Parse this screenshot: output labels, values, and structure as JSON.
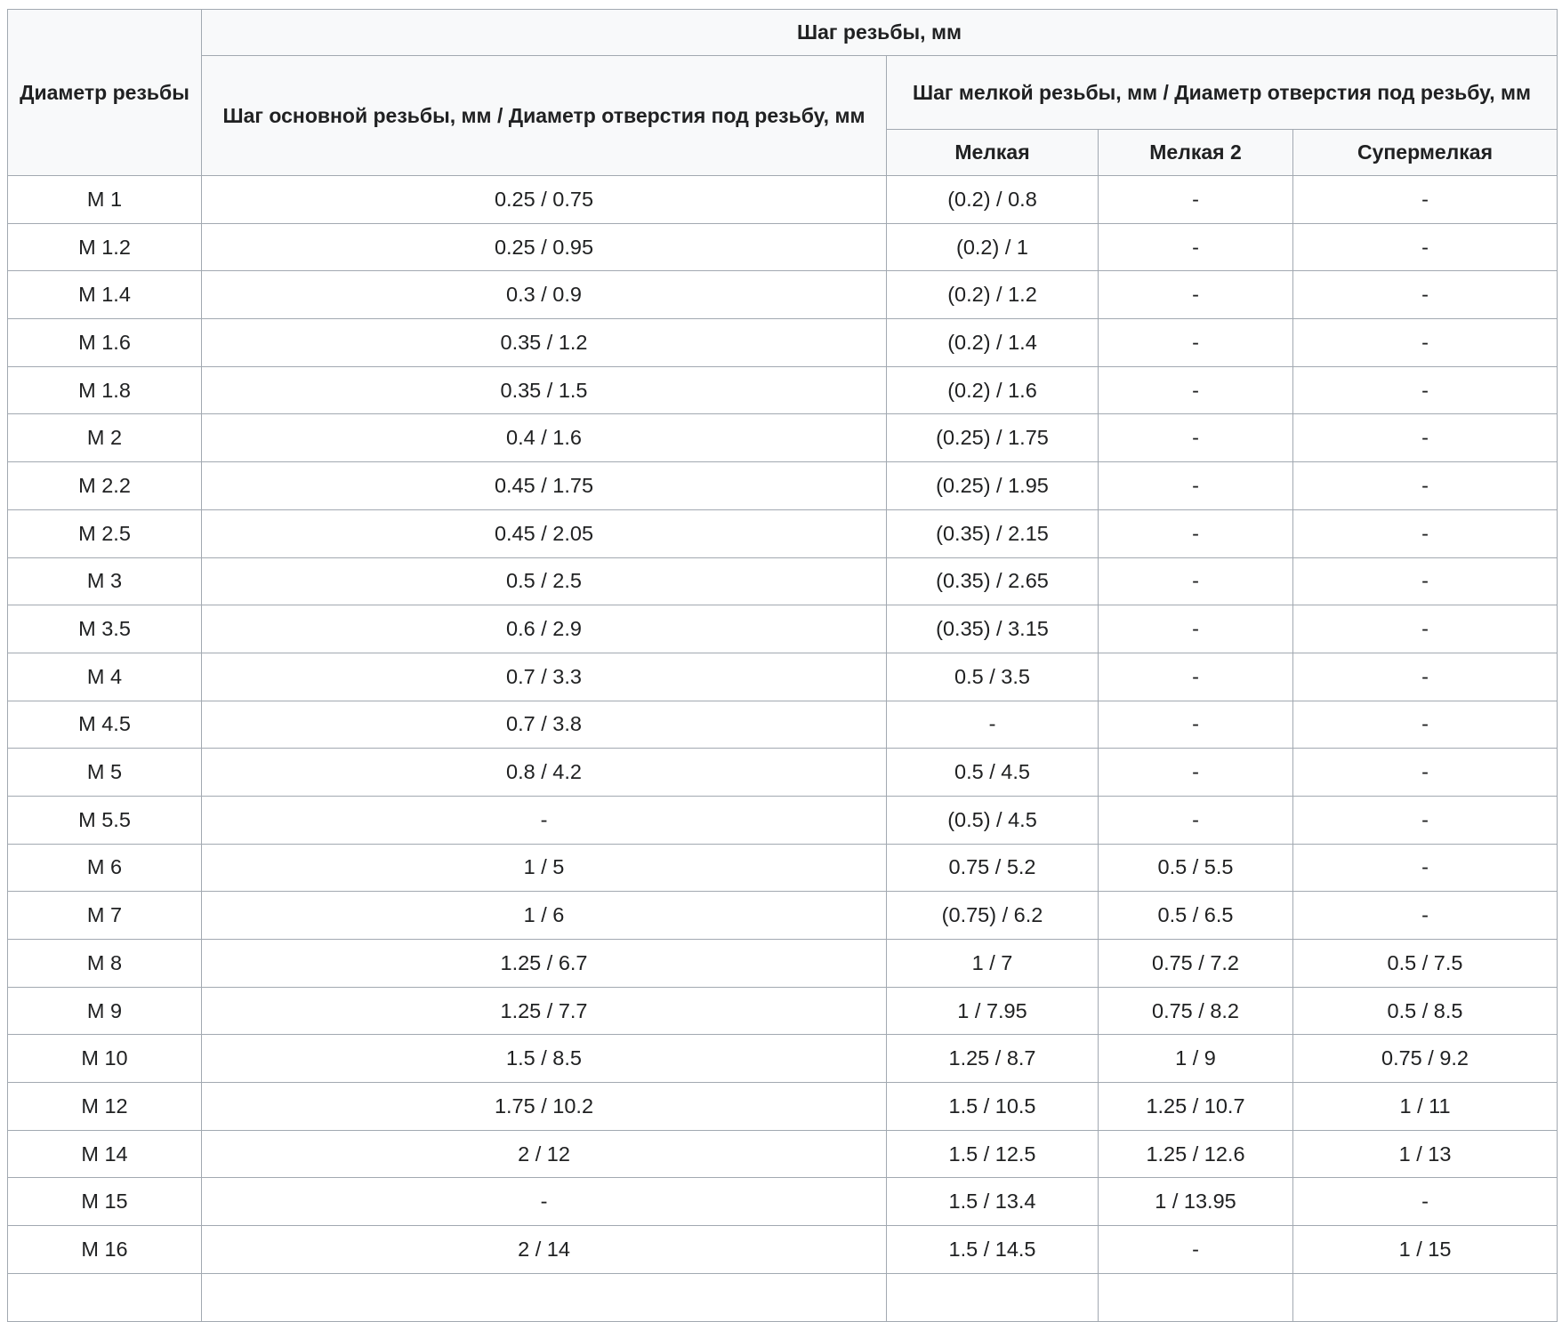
{
  "header": {
    "diameter": "Диаметр резьбы",
    "pitch": "Шаг резьбы, мм",
    "coarse": "Шаг основной резьбы, мм / Диаметр отверстия под резьбу, мм",
    "fine": "Шаг мелкой резьбы, мм / Диаметр отверстия под резьбу, мм",
    "fine1": "Мелкая",
    "fine2": "Мелкая 2",
    "superfine": "Супермелкая"
  },
  "rows": [
    [
      "М 1",
      "0.25 / 0.75",
      "(0.2) / 0.8",
      "-",
      "-"
    ],
    [
      "М 1.2",
      "0.25 / 0.95",
      "(0.2) / 1",
      "-",
      "-"
    ],
    [
      "М 1.4",
      "0.3 / 0.9",
      "(0.2) / 1.2",
      "-",
      "-"
    ],
    [
      "М 1.6",
      "0.35 / 1.2",
      "(0.2) / 1.4",
      "-",
      "-"
    ],
    [
      "М 1.8",
      "0.35 / 1.5",
      "(0.2) / 1.6",
      "-",
      "-"
    ],
    [
      "М 2",
      "0.4 / 1.6",
      "(0.25) / 1.75",
      "-",
      "-"
    ],
    [
      "М 2.2",
      "0.45 / 1.75",
      "(0.25) / 1.95",
      "-",
      "-"
    ],
    [
      "М 2.5",
      "0.45 / 2.05",
      "(0.35) / 2.15",
      "-",
      "-"
    ],
    [
      "М 3",
      "0.5 / 2.5",
      "(0.35) / 2.65",
      "-",
      "-"
    ],
    [
      "М 3.5",
      "0.6 / 2.9",
      "(0.35) / 3.15",
      "-",
      "-"
    ],
    [
      "М 4",
      "0.7 / 3.3",
      "0.5 / 3.5",
      "-",
      "-"
    ],
    [
      "М 4.5",
      "0.7 / 3.8",
      "-",
      "-",
      "-"
    ],
    [
      "М 5",
      "0.8 / 4.2",
      "0.5 / 4.5",
      "-",
      "-"
    ],
    [
      "М 5.5",
      "-",
      "(0.5) / 4.5",
      "-",
      "-"
    ],
    [
      "М 6",
      "1 / 5",
      "0.75 / 5.2",
      "0.5 / 5.5",
      "-"
    ],
    [
      "М 7",
      "1 / 6",
      "(0.75) / 6.2",
      "0.5 / 6.5",
      "-"
    ],
    [
      "М 8",
      "1.25 / 6.7",
      "1 / 7",
      "0.75 / 7.2",
      "0.5 / 7.5"
    ],
    [
      "М 9",
      "1.25 / 7.7",
      "1 / 7.95",
      "0.75 / 8.2",
      "0.5 / 8.5"
    ],
    [
      "М 10",
      "1.5 / 8.5",
      "1.25 / 8.7",
      "1 / 9",
      "0.75 / 9.2"
    ],
    [
      "М 12",
      "1.75 / 10.2",
      "1.5 / 10.5",
      "1.25 / 10.7",
      "1 / 11"
    ],
    [
      "М 14",
      "2 / 12",
      "1.5 / 12.5",
      "1.25 / 12.6",
      "1 / 13"
    ],
    [
      "М 15",
      "-",
      "1.5 / 13.4",
      "1 / 13.95",
      "-"
    ],
    [
      "М 16",
      "2 / 14",
      "1.5 / 14.5",
      "-",
      "1 / 15"
    ],
    [
      "",
      "",
      "",
      "",
      ""
    ]
  ]
}
